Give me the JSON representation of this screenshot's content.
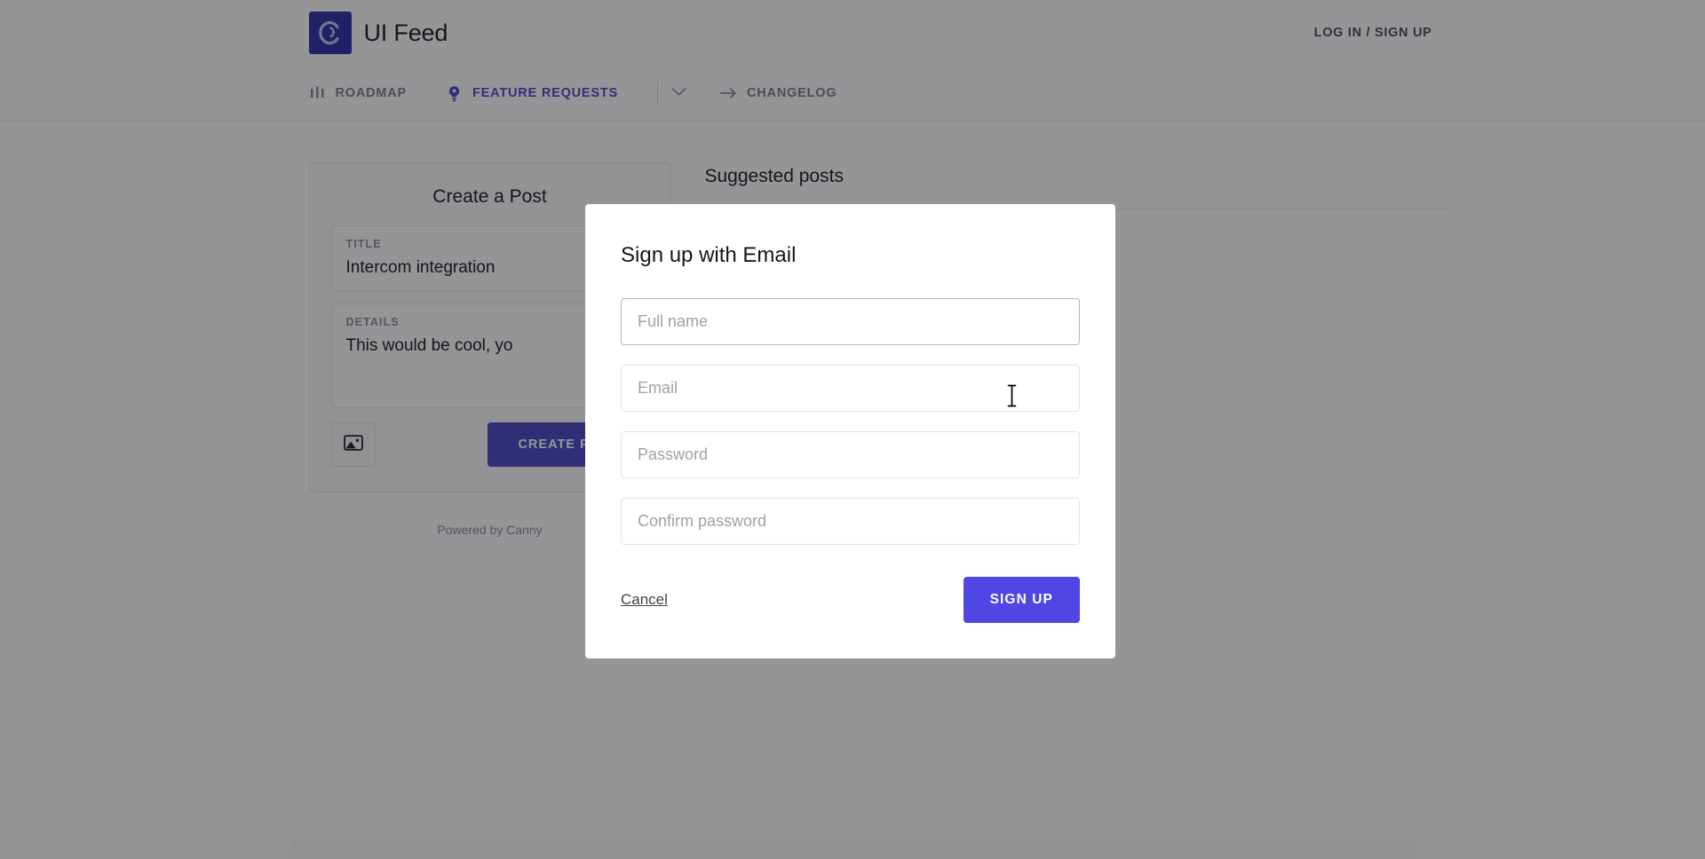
{
  "header": {
    "brand_title": "UI Feed",
    "logo_letter": "C",
    "login_label": "LOG IN / SIGN UP"
  },
  "nav": {
    "items": [
      {
        "label": "ROADMAP",
        "icon": "roadmap-bars-icon",
        "active": false
      },
      {
        "label": "FEATURE REQUESTS",
        "icon": "lightbulb-icon",
        "active": true
      },
      {
        "label": "CHANGELOG",
        "icon": "arrow-right-icon",
        "active": false
      }
    ],
    "caret_icon": "chevron-down-icon"
  },
  "create_post": {
    "card_title": "Create a Post",
    "title_label": "TITLE",
    "title_value": "Intercom integration",
    "details_label": "DETAILS",
    "details_value": "This would be cool, yo",
    "image_icon": "image-upload-icon",
    "submit_label": "CREATE POST"
  },
  "suggested": {
    "heading": "Suggested posts"
  },
  "footer": {
    "powered_by": "Powered by Canny"
  },
  "modal": {
    "title": "Sign up with Email",
    "fields": [
      {
        "name": "full-name",
        "placeholder": "Full name",
        "value": "",
        "focused": true
      },
      {
        "name": "email",
        "placeholder": "Email",
        "value": "",
        "focused": false
      },
      {
        "name": "password",
        "placeholder": "Password",
        "value": "",
        "focused": false
      },
      {
        "name": "confirm-password",
        "placeholder": "Confirm password",
        "value": "",
        "focused": false
      }
    ],
    "cancel_label": "Cancel",
    "submit_label": "SIGN UP"
  },
  "colors": {
    "brand_indigo": "#4944c7",
    "button_indigo": "#5046e4",
    "logo_square": "#2c2ca8",
    "overlay": "rgba(20,20,24,0.45)",
    "text_dark": "#16161d",
    "text_muted": "#8a8a95"
  },
  "cursor": {
    "type": "i-beam"
  }
}
